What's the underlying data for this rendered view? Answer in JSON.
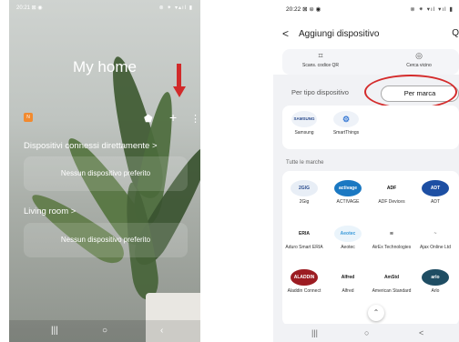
{
  "left": {
    "status_time": "20:21 ⊠ ◉",
    "status_right": "⊗ ⁕ ▾▴ıl ▮",
    "home_title": "My home",
    "badge": "N",
    "section1": "Dispositivi connessi direttamente >",
    "card1": "Nessun dispositivo preferito",
    "section2": "Living room >",
    "card2": "Nessun dispositivo preferito",
    "plus_icon": "+",
    "more_icon": "⋮",
    "bag_icon": "⬟",
    "nav": {
      "recent": "|||",
      "home": "○",
      "back": "‹"
    }
  },
  "right": {
    "status_time": "20:22 ⊠ ⊜ ◉",
    "status_right": "⊗ ⁕ ▾ıl ▾ıl ▮",
    "back_icon": "<",
    "title": "Aggiungi dispositivo",
    "search_icon": "Q",
    "scan_qr_label": "Scans. codice QR",
    "scan_near_label": "Cerca vicino",
    "tab_type": "Per tipo dispositivo",
    "tab_brand": "Per marca",
    "featured": [
      {
        "name": "Samsung",
        "logo": "SAMSUNG"
      },
      {
        "name": "SmartThings",
        "logo": "⚙"
      }
    ],
    "all_brands_title": "Tutte le marche",
    "brands": [
      {
        "name": "2Gig",
        "logo": "2GIG",
        "bg": "#e8eef6",
        "fg": "#2a4b8d"
      },
      {
        "name": "ACTIVAGE",
        "logo": "activage",
        "bg": "#1a78c2",
        "fg": "#ffffff"
      },
      {
        "name": "ADF Devices",
        "logo": "ADF",
        "bg": "#ffffff",
        "fg": "#111111"
      },
      {
        "name": "ADT",
        "logo": "ADT",
        "bg": "#1d4fa3",
        "fg": "#ffffff"
      },
      {
        "name": "Aduro Smart ERIA",
        "logo": "ERIA",
        "bg": "#ffffff",
        "fg": "#222222"
      },
      {
        "name": "Aeotec",
        "logo": "Aeotec",
        "bg": "#eaf4fb",
        "fg": "#3a9ad9"
      },
      {
        "name": "AirEx Technologies",
        "logo": "≋",
        "bg": "#ffffff",
        "fg": "#555555"
      },
      {
        "name": "Ajax Online Ltd",
        "logo": "~",
        "bg": "#ffffff",
        "fg": "#777777"
      },
      {
        "name": "Aladdin Connect",
        "logo": "ALADDIN",
        "bg": "#9c1c22",
        "fg": "#ffffff"
      },
      {
        "name": "Alfred",
        "logo": "Alfred",
        "bg": "#ffffff",
        "fg": "#111111"
      },
      {
        "name": "American Standard",
        "logo": "AmStd",
        "bg": "#ffffff",
        "fg": "#222222"
      },
      {
        "name": "Arlo",
        "logo": "arlo",
        "bg": "#1e4d63",
        "fg": "#ffffff"
      }
    ],
    "nav": {
      "recent": "|||",
      "home": "○",
      "back": "<"
    }
  }
}
